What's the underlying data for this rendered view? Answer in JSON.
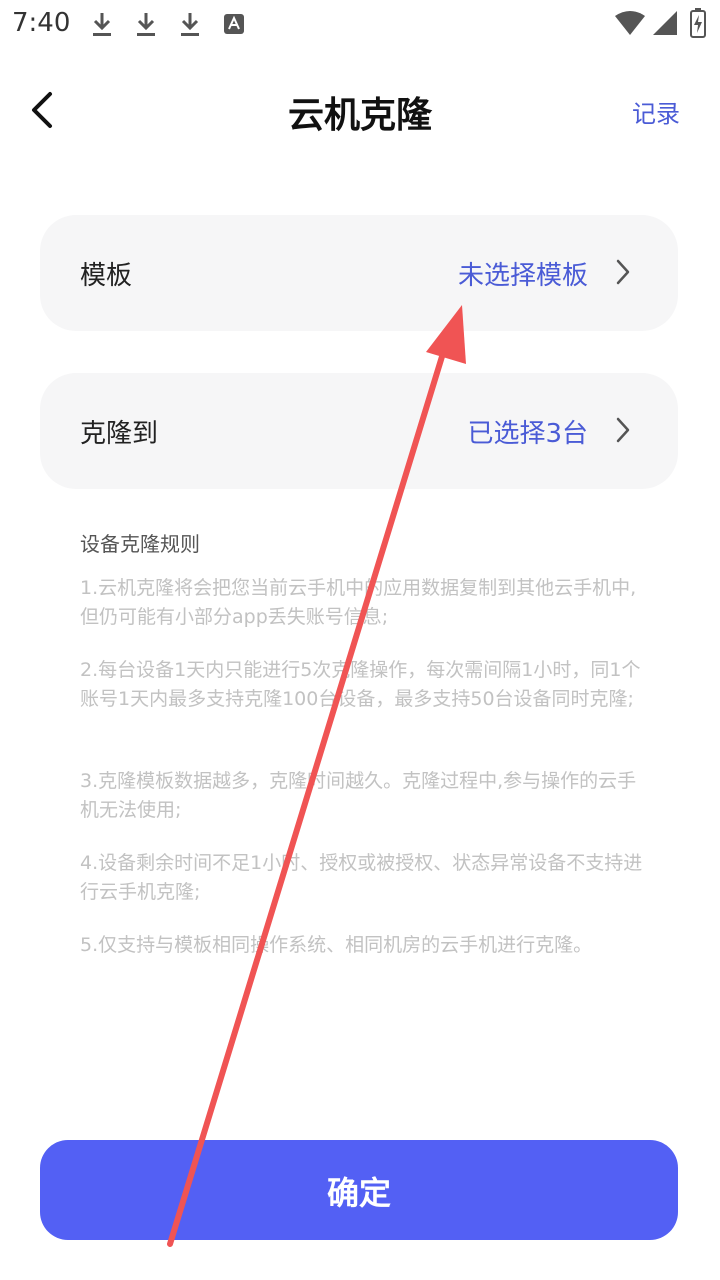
{
  "status_bar": {
    "time": "7:40",
    "icons": [
      "download-icon",
      "download-icon",
      "download-icon",
      "a-notification-icon",
      "wifi-icon",
      "signal-icon",
      "battery-charging-icon"
    ]
  },
  "header": {
    "back_icon": "chevron-left-icon",
    "title": "云机克隆",
    "record_label": "记录"
  },
  "template_row": {
    "label": "模板",
    "value": "未选择模板",
    "icon": "chevron-right-icon"
  },
  "clone_to_row": {
    "label": "克隆到",
    "value": "已选择3台",
    "icon": "chevron-right-icon"
  },
  "rules": {
    "title": "设备克隆规则",
    "items": [
      "1.云机克隆将会把您当前云手机中的应用数据复制到其他云手机中,但仍可能有小部分app丢失账号信息;",
      "2.每台设备1天内只能进行5次克隆操作，每次需间隔1小时，同1个账号1天内最多支持克隆100台设备，最多支持50台设备同时克隆;",
      "3.克隆模板数据越多，克隆时间越久。克隆过程中,参与操作的云手机无法使用;",
      "4.设备剩余时间不足1小时、授权或被授权、状态异常设备不支持进行云手机克隆;",
      "5.仅支持与模板相同操作系统、相同机房的云手机进行克隆。"
    ]
  },
  "confirm_button": {
    "label": "确定"
  },
  "colors": {
    "accent": "#5360f4",
    "link": "#4a5bd6",
    "card_bg": "#f6f6f7",
    "annotation_arrow": "#f05454"
  }
}
